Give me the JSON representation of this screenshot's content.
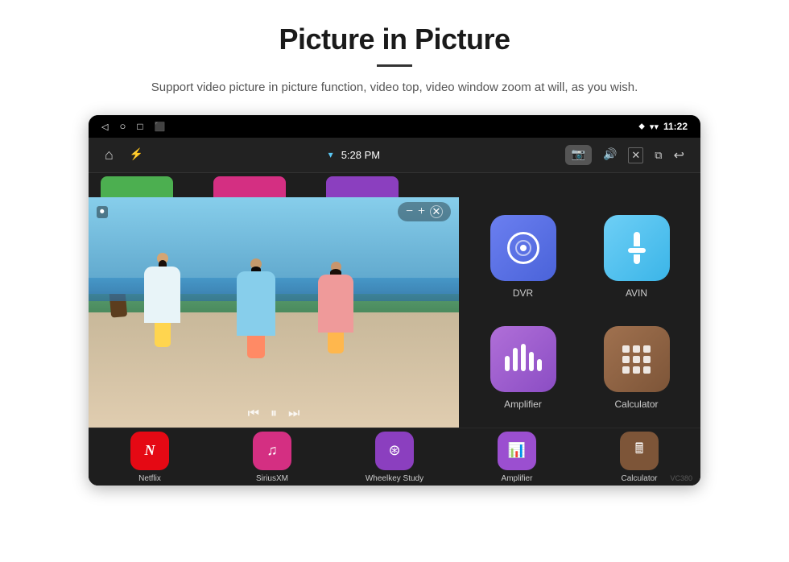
{
  "header": {
    "title": "Picture in Picture",
    "subtitle": "Support video picture in picture function, video top, video window zoom at will, as you wish."
  },
  "status_bar": {
    "time": "11:22",
    "signal_icon": "▾",
    "wifi_icon": "▾",
    "location_icon": "⬥"
  },
  "nav_bar": {
    "time": "5:28 PM",
    "back_icon": "◁",
    "home_icon": "⌂",
    "usb_icon": "⚡",
    "recent_icon": "▣",
    "camera_icon": "📷",
    "volume_icon": "🔊",
    "close_icon": "✕",
    "window_icon": "⧉",
    "undo_icon": "↩"
  },
  "pip_controls": {
    "minus": "−",
    "plus": "+",
    "close": "✕"
  },
  "apps": {
    "top_row": [
      {
        "label": "Netflix",
        "color": "#E50914"
      },
      {
        "label": "SiriusXM",
        "color": "#D42F82"
      },
      {
        "label": "Wheelkey Study",
        "color": "#8B3FBF"
      }
    ],
    "grid": [
      {
        "id": "dvr",
        "label": "DVR",
        "color_start": "#6B7FF0",
        "color_end": "#4A63D9"
      },
      {
        "id": "avin",
        "label": "AVIN",
        "color_start": "#6ECFF6",
        "color_end": "#3BB5E8"
      },
      {
        "id": "amplifier",
        "label": "Amplifier",
        "color_start": "#B06FD8",
        "color_end": "#8B4DC4"
      },
      {
        "id": "calculator",
        "label": "Calculator",
        "color_start": "#A0714F",
        "color_end": "#7D5538"
      }
    ],
    "bottom_row": [
      {
        "label": "Netflix"
      },
      {
        "label": "SiriusXM"
      },
      {
        "label": "Wheelkey Study"
      },
      {
        "label": "Amplifier"
      },
      {
        "label": "Calculator"
      }
    ]
  },
  "watermark": "VC380"
}
